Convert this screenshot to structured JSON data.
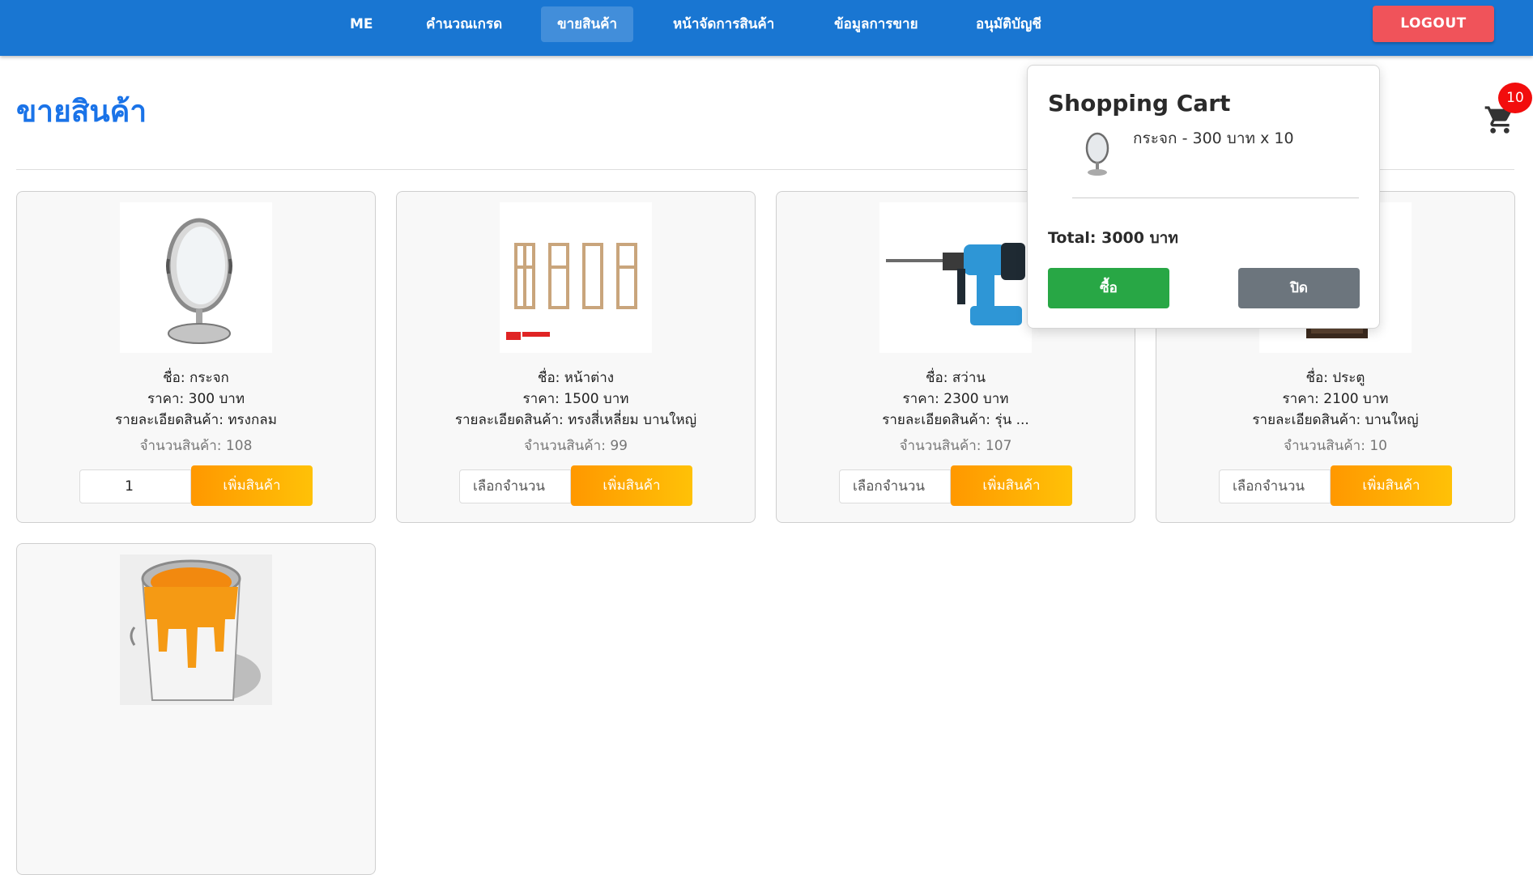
{
  "nav": {
    "items": [
      {
        "label": "ME"
      },
      {
        "label": "คำนวณเกรด"
      },
      {
        "label": "ขายสินค้า"
      },
      {
        "label": "หน้าจัดการสินค้า"
      },
      {
        "label": "ข้อมูลการขาย"
      },
      {
        "label": "อนุมัติบัญชี"
      }
    ],
    "logout_label": "LOGOUT"
  },
  "page": {
    "title": "ขายสินค้า"
  },
  "cart_icon": {
    "icon": "shopping-cart-icon",
    "badge_count": "10"
  },
  "products": [
    {
      "image_icon": "mirror-icon",
      "name": "ชื่อ: กระจก",
      "price": "ราคา: 300 บาท",
      "detail": "รายละเอียดสินค้า: ทรงกลม",
      "stock": "จำนวนสินค้า: 108",
      "qty_value": "1",
      "qty_placeholder": "เลือกจำนวน",
      "add_label": "เพิ่มสินค้า"
    },
    {
      "image_icon": "window-frames-icon",
      "name": "ชื่อ: หน้าต่าง",
      "price": "ราคา: 1500 บาท",
      "detail": "รายละเอียดสินค้า: ทรงสี่เหลี่ยม บานใหญ่",
      "stock": "จำนวนสินค้า: 99",
      "qty_value": "",
      "qty_placeholder": "เลือกจำนวน",
      "add_label": "เพิ่มสินค้า"
    },
    {
      "image_icon": "hammer-drill-icon",
      "name": "ชื่อ: สว่าน",
      "price": "ราคา: 2300 บาท",
      "detail": "รายละเอียดสินค้า: รุ่น ...",
      "stock": "จำนวนสินค้า: 107",
      "qty_value": "",
      "qty_placeholder": "เลือกจำนวน",
      "add_label": "เพิ่มสินค้า"
    },
    {
      "image_icon": "door-icon",
      "name": "ชื่อ: ประตู",
      "price": "ราคา: 2100 บาท",
      "detail": "รายละเอียดสินค้า: บานใหญ่",
      "stock": "จำนวนสินค้า: 10",
      "qty_value": "",
      "qty_placeholder": "เลือกจำนวน",
      "add_label": "เพิ่มสินค้า"
    },
    {
      "image_icon": "paint-bucket-icon"
    }
  ],
  "cart": {
    "title": "Shopping Cart",
    "items": [
      {
        "icon": "mirror-icon",
        "text": "กระจก - 300 บาท x 10"
      }
    ],
    "total": "Total: 3000 บาท",
    "buy_label": "ซื้อ",
    "close_label": "ปิด"
  },
  "colors": {
    "navbar": "#1976d2",
    "logout": "#f0535a",
    "title": "#1a73e8",
    "add_button_from": "#ff9800",
    "add_button_to": "#ffc107",
    "buy": "#28a745",
    "close": "#6c757d",
    "badge": "#f20d0d"
  }
}
